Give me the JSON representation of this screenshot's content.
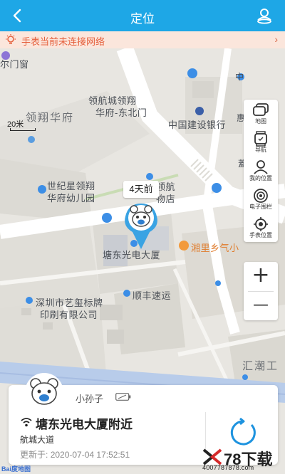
{
  "header": {
    "title": "定位",
    "back_icon": "back-icon",
    "person_icon": "person-location-icon"
  },
  "warning": {
    "text": "手表当前未连接网络",
    "icon": "bulb-icon",
    "arrow": "›"
  },
  "map": {
    "scale_label": "20米",
    "labels": {
      "door": "尔门窗",
      "linghang_gate": "领航城领翔",
      "linghang_gate2": "华府-东北门",
      "lingxiang": "领翔华府",
      "bank": "中国建设银行",
      "kindergarten1": "世纪星领翔",
      "kindergarten2": "华府幼儿园",
      "tangdong": "塘东光电大厦",
      "xiangli": "湘里乡气小",
      "shunfeng": "顺丰速运",
      "yixi1": "深圳市艺玺标牌",
      "yixi2": "印刷有限公司",
      "huichao": "汇潮工",
      "store": "领航",
      "store2": "物店",
      "zhong": "中",
      "hui": "惠",
      "tan": "蓋厂"
    },
    "pin_label": "4天前"
  },
  "tools": [
    {
      "label": "地图",
      "icon": "map-layers-icon"
    },
    {
      "label": "导航",
      "icon": "watch-navigation-icon"
    },
    {
      "label": "我的位置",
      "icon": "my-location-person-icon"
    },
    {
      "label": "电子围栏",
      "icon": "geofence-icon"
    },
    {
      "label": "手表位置",
      "icon": "watch-location-icon"
    }
  ],
  "zoom": {
    "in": "+",
    "out": "—"
  },
  "card": {
    "name": "小孙子",
    "place": "塘东光电大厦附近",
    "street": "航城大道",
    "updated_label": "更新于:",
    "updated_time": "2020-07-04 17:52:51"
  },
  "watermark": {
    "brand": "78下载",
    "phone": "4007787878.com"
  },
  "baidu": "Bai度地图"
}
